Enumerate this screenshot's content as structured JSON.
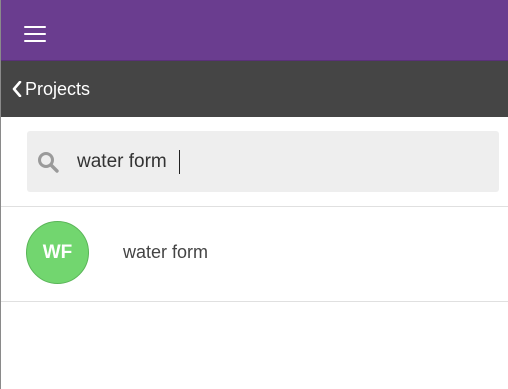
{
  "header": {
    "menu_icon": "hamburger-menu-icon",
    "accent_color": "#6a3d8f"
  },
  "nav": {
    "back_label": "Projects",
    "back_icon": "chevron-left-icon",
    "bar_color": "#454545"
  },
  "search": {
    "value": "water form",
    "icon": "search-icon"
  },
  "results": [
    {
      "initials": "WF",
      "label": "water form",
      "avatar_color": "#72d66f"
    }
  ]
}
